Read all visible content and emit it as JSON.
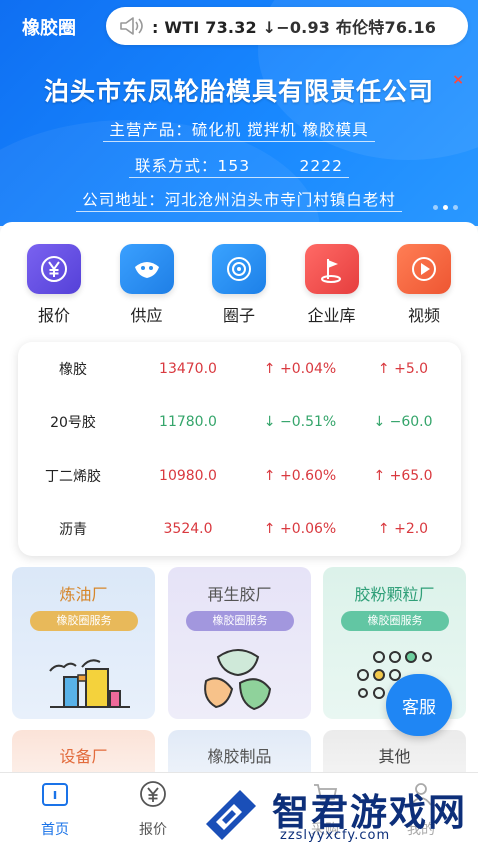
{
  "app": {
    "title": "橡胶圈"
  },
  "ticker": {
    "text": ": WTI 73.32 ↓−0.93 布伦特76.16"
  },
  "banner": {
    "company": "泊头市东凤轮胎模具有限责任公司",
    "close": "×",
    "products": "主营产品：硫化机 搅拌机 橡胶模具",
    "contact": "联系方式：153　　　2222",
    "address": "公司地址：河北沧州泊头市寺门村镇白老村",
    "slides": 3,
    "active_slide": 2
  },
  "quick_nav": [
    {
      "label": "报价",
      "icon": "yen-icon",
      "color": "#6a55e8"
    },
    {
      "label": "供应",
      "icon": "handshake-icon",
      "color": "#2e8ff0"
    },
    {
      "label": "圈子",
      "icon": "circle-target-icon",
      "color": "#2a93ee"
    },
    {
      "label": "企业库",
      "icon": "flag-icon",
      "color": "#f0504f"
    },
    {
      "label": "视频",
      "icon": "play-icon",
      "color": "#f3673f"
    }
  ],
  "prices": [
    {
      "name": "橡胶",
      "price": "13470.0",
      "pct": "↑ +0.04%",
      "chg": "↑ +5.0",
      "dir": "up"
    },
    {
      "name": "20号胶",
      "price": "11780.0",
      "pct": "↓ −0.51%",
      "chg": "↓ −60.0",
      "dir": "down"
    },
    {
      "name": "丁二烯胶",
      "price": "10980.0",
      "pct": "↑ +0.60%",
      "chg": "↑ +65.0",
      "dir": "up"
    },
    {
      "name": "沥青",
      "price": "3524.0",
      "pct": "↑ +0.06%",
      "chg": "↑ +2.0",
      "dir": "up"
    }
  ],
  "services": [
    {
      "title": "炼油厂",
      "tag": "橡胶圈服务",
      "bg": "#dce9f8",
      "title_color": "#d6862a",
      "tag_color": "#e5b553"
    },
    {
      "title": "再生胶厂",
      "tag": "橡胶圈服务",
      "bg": "#e6e4f7",
      "title_color": "#555555",
      "tag_color": "#9d93dc"
    },
    {
      "title": "胶粉颗粒厂",
      "tag": "橡胶圈服务",
      "bg": "#dff3ec",
      "title_color": "#2f9f78",
      "tag_color": "#5fc3a0"
    }
  ],
  "services_row2": [
    {
      "title": "设备厂",
      "bg": "#fbe6dc",
      "title_color": "#e26b3c"
    },
    {
      "title": "橡胶制品",
      "bg": "#e3ebf6",
      "title_color": "#555555"
    },
    {
      "title": "其他",
      "bg": "#ececec",
      "title_color": "#444444"
    }
  ],
  "kefu": {
    "label": "客服"
  },
  "tabs": [
    {
      "label": "首页",
      "icon": "home-icon",
      "active": true
    },
    {
      "label": "报价",
      "icon": "yen-circle-icon",
      "active": false
    },
    {
      "label": "采购",
      "icon": "cart-icon",
      "active": false
    },
    {
      "label": "我的",
      "icon": "user-icon",
      "active": false
    }
  ],
  "watermark": {
    "brand": "智君游戏网",
    "url": "zzslyyxcfy.com"
  }
}
